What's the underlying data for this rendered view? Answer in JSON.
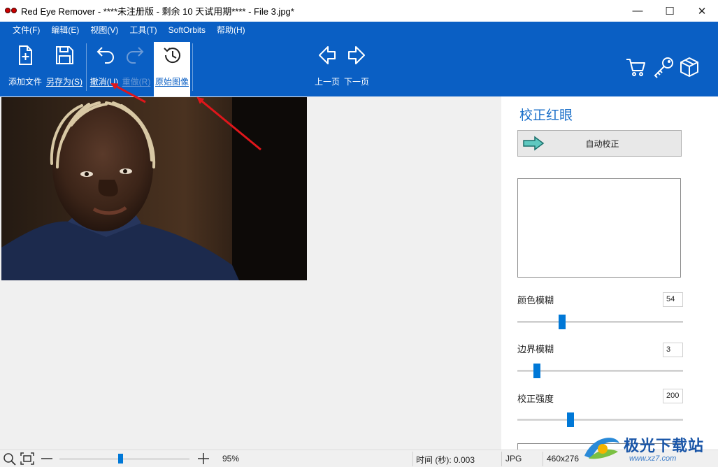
{
  "window": {
    "title": "Red Eye Remover - ****未注册版 - 剩余 10 天试用期**** - File 3.jpg*",
    "minimize_glyph": "—",
    "maximize_glyph": "☐",
    "close_glyph": "✕"
  },
  "menu": {
    "items": [
      {
        "label": "文件(F)"
      },
      {
        "label": "编辑(E)"
      },
      {
        "label": "视图(V)"
      },
      {
        "label": "工具(T)"
      },
      {
        "label": "SoftOrbits"
      },
      {
        "label": "帮助(H)"
      }
    ]
  },
  "toolbar": {
    "add_file": "添加文件",
    "save_as": "另存为(S)",
    "undo": "撤消(U)",
    "redo": "重做(R)",
    "original_image": "原始图像",
    "prev_page": "上一页",
    "next_page": "下一页",
    "icons": [
      "add-file-icon",
      "save-icon",
      "undo-icon",
      "redo-icon",
      "history-icon",
      "prev-arrow-icon",
      "next-arrow-icon",
      "cart-icon",
      "key-icon",
      "box-icon"
    ]
  },
  "panel": {
    "title": "校正红眼",
    "auto_fix_label": "自动校正",
    "sliders": [
      {
        "label": "颜色模糊",
        "value": "54",
        "level": 0.27
      },
      {
        "label": "边界模糊",
        "value": "3",
        "level": 0.12
      },
      {
        "label": "校正强度",
        "value": "200",
        "level": 0.32
      }
    ]
  },
  "status": {
    "zoom": "95%",
    "zoom_level": 0.47,
    "time": "时间 (秒): 0.003",
    "format": "JPG",
    "dimensions": "460x276"
  },
  "watermark": {
    "text": "极光下载站",
    "sub": "www.xz7.com"
  },
  "colors": {
    "accent": "#0a5fc4",
    "slider_thumb": "#0078d7",
    "annotation_arrow": "#e0161b"
  }
}
